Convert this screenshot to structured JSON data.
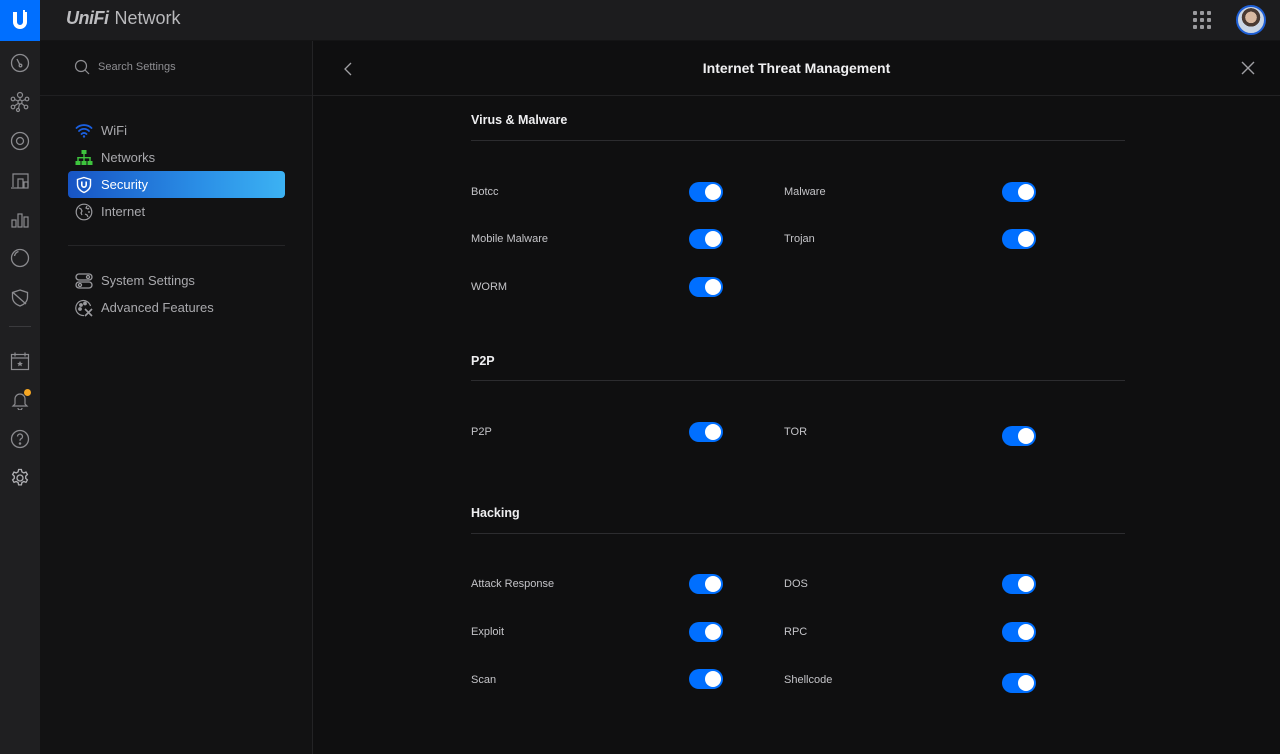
{
  "app": {
    "brand_italic": "UniFi",
    "brand_name": "Network"
  },
  "topbar": {
    "apps_icon": "grid-icon",
    "avatar_icon": "user-avatar"
  },
  "rail": {
    "items": [
      {
        "icon": "dashboard-icon"
      },
      {
        "icon": "topology-icon"
      },
      {
        "icon": "devices-icon"
      },
      {
        "icon": "clients-icon"
      },
      {
        "icon": "statistics-icon"
      },
      {
        "icon": "insights-icon"
      },
      {
        "icon": "shield-icon"
      },
      {
        "icon": "events-calendar-icon"
      },
      {
        "icon": "alerts-bell-icon",
        "has_badge": true,
        "badge_color": "#f5a623"
      },
      {
        "icon": "help-icon"
      },
      {
        "icon": "settings-gear-icon"
      }
    ]
  },
  "sidebar": {
    "search_placeholder": "Search Settings",
    "items": [
      {
        "label": "WiFi",
        "icon": "wifi-icon",
        "color": "#1a5fe0"
      },
      {
        "label": "Networks",
        "icon": "network-tree-icon",
        "color": "#3ec43e"
      },
      {
        "label": "Security",
        "icon": "security-shield-icon",
        "active": true
      },
      {
        "label": "Internet",
        "icon": "globe-icon"
      },
      {
        "label": "System Settings",
        "icon": "system-toggles-icon"
      },
      {
        "label": "Advanced Features",
        "icon": "advanced-tools-icon"
      }
    ]
  },
  "main": {
    "title": "Internet Threat Management",
    "accent_color": "#006fff",
    "sections": [
      {
        "title": "Virus & Malware",
        "options": [
          {
            "label": "Botcc",
            "enabled": true
          },
          {
            "label": "Malware",
            "enabled": true
          },
          {
            "label": "Mobile Malware",
            "enabled": true
          },
          {
            "label": "Trojan",
            "enabled": true
          },
          {
            "label": "WORM",
            "enabled": true
          }
        ]
      },
      {
        "title": "P2P",
        "options": [
          {
            "label": "P2P",
            "enabled": true
          },
          {
            "label": "TOR",
            "enabled": true
          }
        ]
      },
      {
        "title": "Hacking",
        "options": [
          {
            "label": "Attack Response",
            "enabled": true
          },
          {
            "label": "DOS",
            "enabled": true
          },
          {
            "label": "Exploit",
            "enabled": true
          },
          {
            "label": "RPC",
            "enabled": true
          },
          {
            "label": "Scan",
            "enabled": true
          },
          {
            "label": "Shellcode",
            "enabled": true
          }
        ]
      }
    ]
  }
}
